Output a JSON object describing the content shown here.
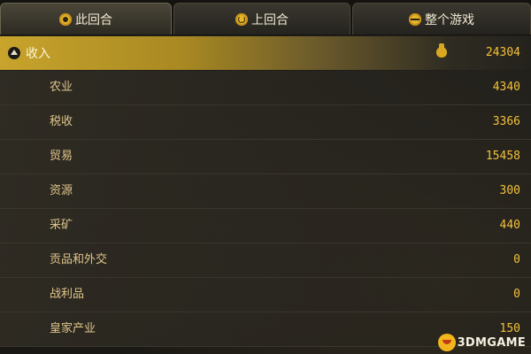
{
  "tabs": [
    {
      "label": "此回合",
      "icon": "current-turn-icon",
      "active": true
    },
    {
      "label": "上回合",
      "icon": "previous-turn-icon",
      "active": false
    },
    {
      "label": "整个游戏",
      "icon": "whole-game-icon",
      "active": false
    }
  ],
  "income": {
    "label": "收入",
    "toggle_icon": "collapse-arrow-icon",
    "currency_icon": "moneybag-icon",
    "value": "24304"
  },
  "rows": [
    {
      "label": "农业",
      "value": "4340"
    },
    {
      "label": "税收",
      "value": "3366"
    },
    {
      "label": "贸易",
      "value": "15458"
    },
    {
      "label": "资源",
      "value": "300"
    },
    {
      "label": "采矿",
      "value": "440"
    },
    {
      "label": "贡品和外交",
      "value": "0"
    },
    {
      "label": "战利品",
      "value": "0"
    },
    {
      "label": "皇家产业",
      "value": "150"
    }
  ],
  "watermark": {
    "text": "3DMGAME"
  },
  "colors": {
    "accent_gold": "#c8a42c",
    "value_text": "#f3c23a",
    "label_text": "#dfc58a",
    "background": "#1c1a15"
  }
}
